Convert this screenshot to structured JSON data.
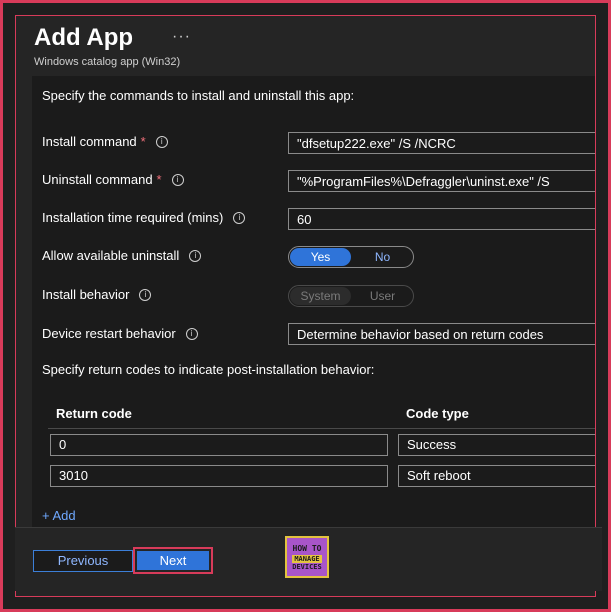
{
  "header": {
    "title": "Add App",
    "more": "···",
    "subtitle": "Windows catalog app (Win32)"
  },
  "intro": "Specify the commands to install and uninstall this app:",
  "fields": {
    "install_command": {
      "label": "Install command",
      "required": "*",
      "value": "\"dfsetup222.exe\" /S /NCRC"
    },
    "uninstall_command": {
      "label": "Uninstall command",
      "required": "*",
      "value": "\"%ProgramFiles%\\Defraggler\\uninst.exe\" /S"
    },
    "install_time": {
      "label": "Installation time required (mins)",
      "value": "60"
    },
    "allow_uninstall": {
      "label": "Allow available uninstall",
      "option_on": "Yes",
      "option_off": "No"
    },
    "install_behavior": {
      "label": "Install behavior",
      "option_1": "System",
      "option_2": "User"
    },
    "restart_behavior": {
      "label": "Device restart behavior",
      "value": "Determine behavior based on return codes"
    }
  },
  "info_glyph": "i",
  "return_codes": {
    "label": "Specify return codes to indicate post-installation behavior:",
    "col_code": "Return code",
    "col_type": "Code type",
    "rows": [
      {
        "code": "0",
        "type": "Success"
      },
      {
        "code": "3010",
        "type": "Soft reboot"
      }
    ],
    "add": "+ Add"
  },
  "footer": {
    "previous": "Previous",
    "next": "Next"
  },
  "logo": {
    "line1": "HOW TO",
    "line2": "MANAGE",
    "line3": "DEVICES"
  },
  "colors": {
    "accent": "#2f74d9",
    "highlight_border": "#d83b5a",
    "required": "#f1707b"
  }
}
